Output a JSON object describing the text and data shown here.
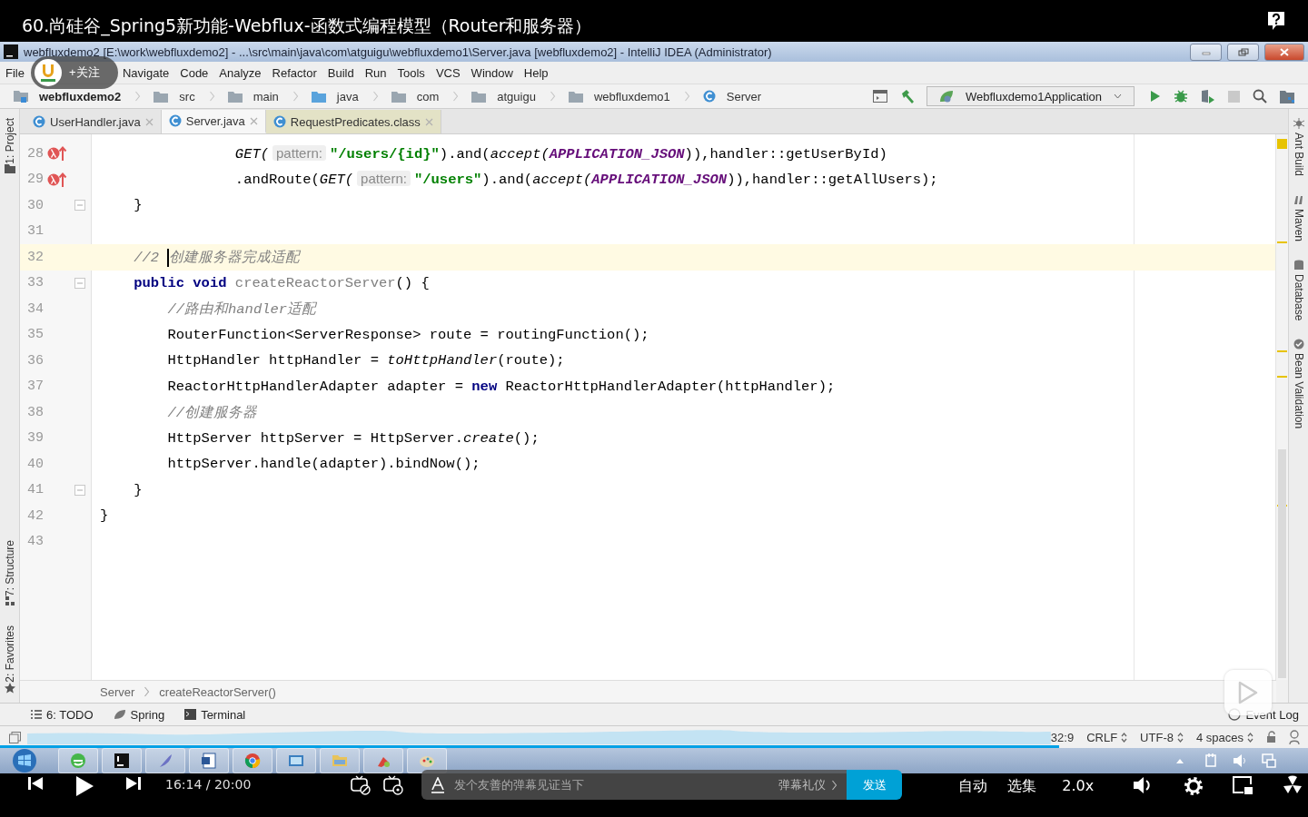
{
  "video_title": "60.尚硅谷_Spring5新功能-Webflux-函数式编程模型（Router和服务器）",
  "follow": "+关注",
  "ide": {
    "window_title": "webfluxdemo2 [E:\\work\\webfluxdemo2] - ...\\src\\main\\java\\com\\atguigu\\webfluxdemo1\\Server.java [webfluxdemo2] - IntelliJ IDEA (Administrator)",
    "menu": [
      "File",
      "Navigate",
      "Code",
      "Analyze",
      "Refactor",
      "Build",
      "Run",
      "Tools",
      "VCS",
      "Window",
      "Help"
    ],
    "breadcrumbs": [
      {
        "label": "webfluxdemo2",
        "kind": "module"
      },
      {
        "label": "src",
        "kind": "folder"
      },
      {
        "label": "main",
        "kind": "folder"
      },
      {
        "label": "java",
        "kind": "source"
      },
      {
        "label": "com",
        "kind": "folder"
      },
      {
        "label": "atguigu",
        "kind": "folder"
      },
      {
        "label": "webfluxdemo1",
        "kind": "folder"
      },
      {
        "label": "Server",
        "kind": "class"
      }
    ],
    "run_config": "Webfluxdemo1Application",
    "tabs": [
      {
        "label": "UserHandler.java",
        "selected": false,
        "library": false
      },
      {
        "label": "Server.java",
        "selected": true,
        "library": false
      },
      {
        "label": "RequestPredicates.class",
        "selected": false,
        "library": true
      }
    ],
    "left_tools": [
      "1: Project",
      "7: Structure",
      "2: Favorites"
    ],
    "right_tools": [
      "Ant Build",
      "Maven",
      "Database",
      "Bean Validation"
    ],
    "code_lines": [
      {
        "number": "28",
        "kind": "lambda",
        "fold": false,
        "current": false,
        "tokens": [
          {
            "kind": "italic",
            "text": "                GET("
          },
          {
            "kind": "hint",
            "text": "pattern:"
          },
          {
            "kind": "string",
            "text": "\"/users/{id}\""
          },
          {
            "kind": "plain",
            "text": ").and("
          },
          {
            "kind": "italic",
            "text": "accept("
          },
          {
            "kind": "const",
            "text": "APPLICATION_JSON"
          },
          {
            "kind": "plain",
            "text": ")),handler::getUserById)"
          }
        ]
      },
      {
        "number": "29",
        "kind": "lambda",
        "fold": false,
        "current": false,
        "tokens": [
          {
            "kind": "plain",
            "text": "                .andRoute("
          },
          {
            "kind": "italic",
            "text": "GET("
          },
          {
            "kind": "hint",
            "text": "pattern:"
          },
          {
            "kind": "string",
            "text": "\"/users\""
          },
          {
            "kind": "plain",
            "text": ").and("
          },
          {
            "kind": "italic",
            "text": "accept("
          },
          {
            "kind": "const",
            "text": "APPLICATION_JSON"
          },
          {
            "kind": "plain",
            "text": ")),handler::getAllUsers);"
          }
        ]
      },
      {
        "number": "30",
        "kind": "plain",
        "fold": true,
        "current": false,
        "tokens": [
          {
            "kind": "plain",
            "text": "    }"
          }
        ]
      },
      {
        "number": "31",
        "kind": "plain",
        "fold": false,
        "current": false
      },
      {
        "number": "32",
        "kind": "plain",
        "fold": false,
        "current": true,
        "tokens": [
          {
            "kind": "comment",
            "text": "    //2 "
          },
          {
            "kind": "caret"
          },
          {
            "kind": "comment",
            "text": "创建服务器完成适配"
          }
        ]
      },
      {
        "number": "33",
        "kind": "plain",
        "fold": true,
        "current": false,
        "tokens": [
          {
            "kind": "keyword",
            "text": "    public void "
          },
          {
            "kind": "unused",
            "text": "createReactorServer"
          },
          {
            "kind": "plain",
            "text": "() {"
          }
        ]
      },
      {
        "number": "34",
        "kind": "plain",
        "fold": false,
        "current": false,
        "tokens": [
          {
            "kind": "comment",
            "text": "        //路由和handler适配"
          }
        ]
      },
      {
        "number": "35",
        "kind": "plain",
        "fold": false,
        "current": false,
        "tokens": [
          {
            "kind": "plain",
            "text": "        RouterFunction<ServerResponse> route = routingFunction();"
          }
        ]
      },
      {
        "number": "36",
        "kind": "plain",
        "fold": false,
        "current": false,
        "tokens": [
          {
            "kind": "plain",
            "text": "        HttpHandler httpHandler = "
          },
          {
            "kind": "italic",
            "text": "toHttpHandler"
          },
          {
            "kind": "plain",
            "text": "(route);"
          }
        ]
      },
      {
        "number": "37",
        "kind": "plain",
        "fold": false,
        "current": false,
        "tokens": [
          {
            "kind": "plain",
            "text": "        ReactorHttpHandlerAdapter adapter = "
          },
          {
            "kind": "keyword",
            "text": "new"
          },
          {
            "kind": "plain",
            "text": " ReactorHttpHandlerAdapter(httpHandler);"
          }
        ]
      },
      {
        "number": "38",
        "kind": "plain",
        "fold": false,
        "current": false,
        "tokens": [
          {
            "kind": "comment",
            "text": "        //创建服务器"
          }
        ]
      },
      {
        "number": "39",
        "kind": "plain",
        "fold": false,
        "current": false,
        "tokens": [
          {
            "kind": "plain",
            "text": "        HttpServer httpServer = HttpServer."
          },
          {
            "kind": "italic",
            "text": "create"
          },
          {
            "kind": "plain",
            "text": "();"
          }
        ]
      },
      {
        "number": "40",
        "kind": "plain",
        "fold": false,
        "current": false,
        "tokens": [
          {
            "kind": "plain",
            "text": "        httpServer.handle(adapter).bindNow();"
          }
        ]
      },
      {
        "number": "41",
        "kind": "plain",
        "fold": true,
        "current": false,
        "tokens": [
          {
            "kind": "plain",
            "text": "    }"
          }
        ]
      },
      {
        "number": "42",
        "kind": "plain",
        "fold": false,
        "current": false,
        "tokens": [
          {
            "kind": "plain",
            "text": "}"
          }
        ]
      },
      {
        "number": "43",
        "kind": "plain",
        "fold": false,
        "current": false
      }
    ],
    "code_breadcrumbs": [
      "Server",
      "createReactorServer()"
    ],
    "tool_windows": [
      {
        "label": "6: TODO",
        "kind": "todo"
      },
      {
        "label": "Spring",
        "kind": "spring"
      },
      {
        "label": "Terminal",
        "kind": "terminal"
      }
    ],
    "event_log": "Event Log",
    "status": [
      "32:9",
      "CRLF",
      "UTF-8",
      "4 spaces"
    ]
  },
  "player": {
    "progress": {
      "level": 0.81
    },
    "time": "16:14 / 20:00",
    "danmaku_placeholder": "发个友善的弹幕见证当下",
    "etiquette": "弹幕礼仪",
    "send": "发送",
    "quality": "自动",
    "episodes": "选集",
    "speed": "2.0x"
  }
}
